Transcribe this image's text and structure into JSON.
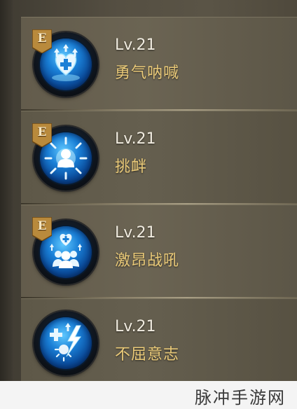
{
  "skills": [
    {
      "badge": "E",
      "level": "Lv.21",
      "name": "勇气呐喊",
      "icon": "heart-plus-icon"
    },
    {
      "badge": "E",
      "level": "Lv.21",
      "name": "挑衅",
      "icon": "taunt-figure-icon"
    },
    {
      "badge": "E",
      "level": "Lv.21",
      "name": "激昂战吼",
      "icon": "group-heart-icon"
    },
    {
      "level": "Lv.21",
      "name": "不屈意志",
      "icon": "plus-lightning-icon"
    }
  ],
  "watermark": "脉冲手游网",
  "colors": {
    "skill_name": "#e9c978",
    "level_text": "#f1ece0",
    "icon_blue": "#1a7fd6",
    "badge": "#b98a3c"
  }
}
